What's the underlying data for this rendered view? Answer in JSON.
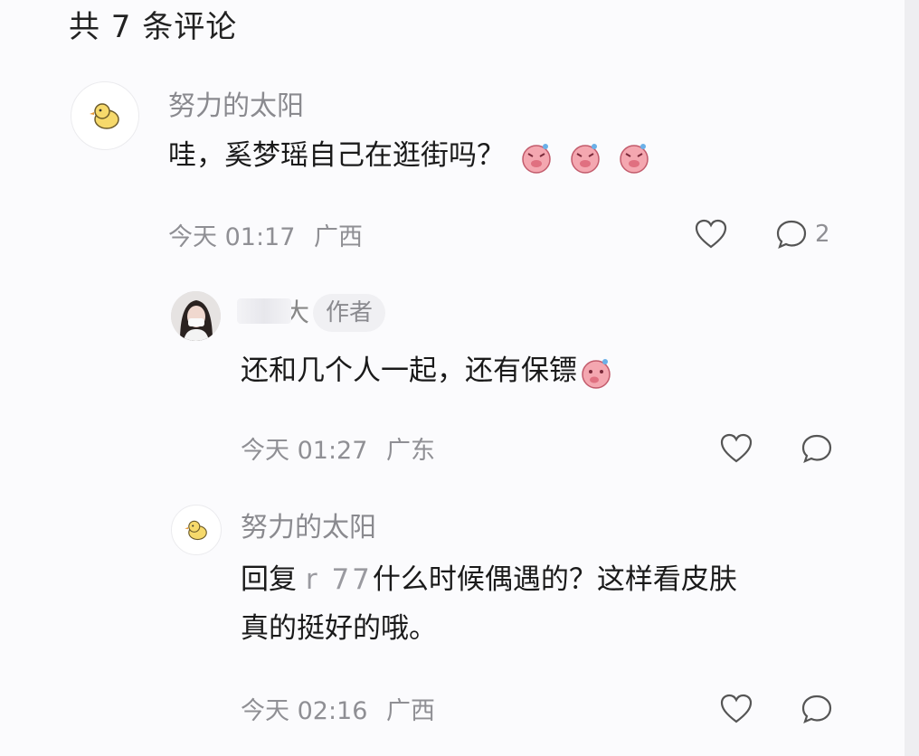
{
  "header": {
    "title": "共 7 条评论"
  },
  "comments": [
    {
      "username": "努力的太阳",
      "text": "哇，奚梦瑶自己在逛街吗？",
      "time": "今天 01:17",
      "location": "广西",
      "reply_count": "2",
      "emoji_count": 3
    }
  ],
  "replies": [
    {
      "username_visible": "大",
      "badge": "作者",
      "text": "还和几个人一起，还有保镖",
      "time": "今天 01:27",
      "location": "广东"
    },
    {
      "username": "努力的太阳",
      "prefix": "回复",
      "mention": "r  77",
      "text_line1": "什么时候偶遇的？这样看皮肤",
      "text_line2": "真的挺好的哦。",
      "time": "今天 02:16",
      "location": "广西"
    }
  ],
  "colors": {
    "meta_gray": "#8f8f94",
    "emoji_pink": "#f4a7b0",
    "duck_yellow": "#f6d96b"
  },
  "icons": [
    "duck-avatar-icon",
    "heart-icon",
    "comment-bubble-icon",
    "pig-emoji-icon"
  ]
}
